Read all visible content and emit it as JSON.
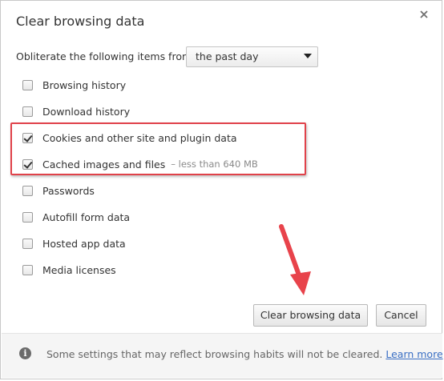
{
  "dialog": {
    "title": "Clear browsing data",
    "close_icon": "close-icon"
  },
  "time_range": {
    "label": "Obliterate the following items from:",
    "selected": "the past day"
  },
  "items": [
    {
      "label": "Browsing history",
      "checked": false
    },
    {
      "label": "Download history",
      "checked": false
    },
    {
      "label": "Cookies and other site and plugin data",
      "checked": true
    },
    {
      "label": "Cached images and files",
      "checked": true,
      "detail": "–  less than 640 MB"
    },
    {
      "label": "Passwords",
      "checked": false
    },
    {
      "label": "Autofill form data",
      "checked": false
    },
    {
      "label": "Hosted app data",
      "checked": false
    },
    {
      "label": "Media licenses",
      "checked": false
    }
  ],
  "buttons": {
    "clear_label": "Clear browsing data",
    "cancel_label": "Cancel"
  },
  "footer": {
    "info_icon": "info-icon",
    "text": "Some settings that may reflect browsing habits will not be cleared.",
    "link": "Learn more"
  },
  "annotations": {
    "highlight_color": "#e0424a",
    "arrow_color": "#e8434b"
  }
}
